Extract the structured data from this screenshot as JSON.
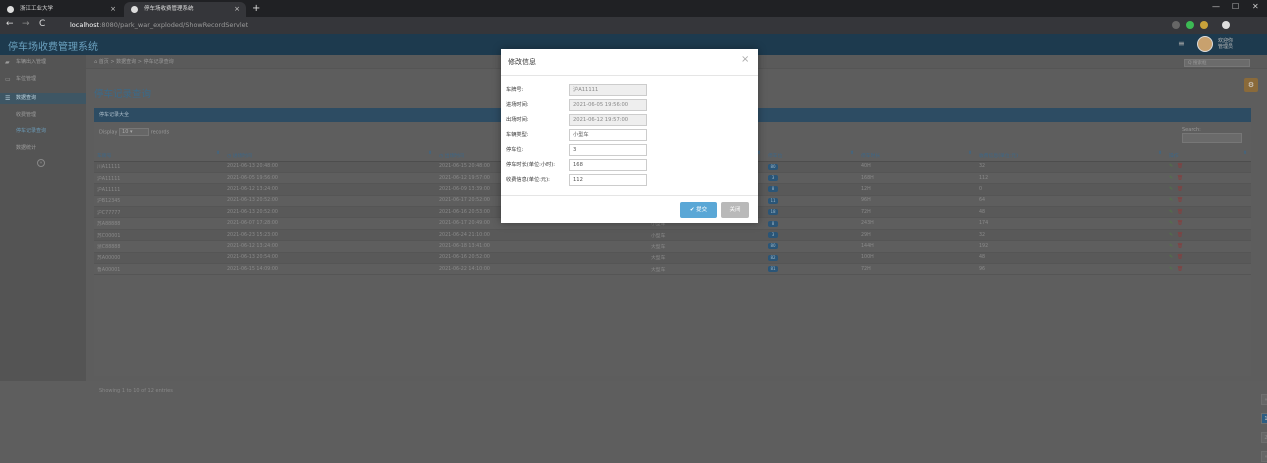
{
  "browser": {
    "tabs": [
      {
        "title": "浙江工业大学",
        "close": "×"
      },
      {
        "title": "停车场收费管理系统",
        "close": "×"
      }
    ],
    "new_tab": "+",
    "window_controls": [
      "—",
      "☐",
      "✕"
    ],
    "nav": {
      "back": "←",
      "forward": "→",
      "reload": "C"
    },
    "url_host": "localhost",
    "url_path": ":8080/park_war_exploded/ShowRecordServlet"
  },
  "app": {
    "brand": "停车场收费管理系统",
    "user_lines": [
      "欢迎你",
      "管理员"
    ],
    "menu_icon": "≡"
  },
  "sidebar": {
    "items": [
      {
        "label": "车辆出入管理",
        "icon": "car-icon"
      },
      {
        "label": "车位管理",
        "icon": "monitor-icon"
      },
      {
        "label": "数据查询",
        "icon": "list-icon"
      }
    ],
    "subitems": [
      "收费管理",
      "停车记录查询",
      "数据统计"
    ],
    "collapse": "«"
  },
  "breadcrumb": {
    "home": "首页",
    "sep": ">",
    "level1": "数据查询",
    "level2": "停车记录查询"
  },
  "search_top": {
    "placeholder": "Q 搜索框"
  },
  "page_title": "停车记录查询",
  "panel": {
    "title": "停车记录大全",
    "display": "Display",
    "page_size": "10",
    "records": "records",
    "search_label": "Search:"
  },
  "table": {
    "headers": [
      "车牌号",
      "◷ 进场时间",
      "◷ 出场时间",
      "车辆类型",
      "停车位",
      "停车时长",
      "收费信息(单位:元)",
      "操作"
    ],
    "rows": [
      [
        "川A11111",
        "2021-06-13 20:48:00",
        "2021-06-15 20:48:00",
        "小型车",
        "80",
        "40H",
        "32"
      ],
      [
        "沪A11111",
        "2021-06-05 19:56:00",
        "2021-06-12 19:57:00",
        "小型车",
        "3",
        "168H",
        "112"
      ],
      [
        "沪A11111",
        "2021-06-12 13:24:00",
        "2021-06-09 13:39:00",
        "小型车",
        "8",
        "12H",
        "0"
      ],
      [
        "沪B12345",
        "2021-06-13 20:52:00",
        "2021-06-17 20:52:00",
        "小型车",
        "11",
        "96H",
        "64"
      ],
      [
        "沪C77777",
        "2021-06-13 20:52:00",
        "2021-06-16 20:53:00",
        "大型车",
        "18",
        "72H",
        "48"
      ],
      [
        "苏A88888",
        "2021-06-07 17:28:00",
        "2021-06-17 20:49:00",
        "小型车",
        "8",
        "243H",
        "174"
      ],
      [
        "苏C00001",
        "2021-06-23 15:23:00",
        "2021-06-24 21:10:00",
        "小型车",
        "3",
        "29H",
        "32"
      ],
      [
        "浙C88888",
        "2021-06-12 13:24:00",
        "2021-06-18 13:41:00",
        "大型车",
        "80",
        "144H",
        "192"
      ],
      [
        "苏A00000",
        "2021-06-13 20:54:00",
        "2021-06-16 20:52:00",
        "大型车",
        "82",
        "100H",
        "48"
      ],
      [
        "鲁A00001",
        "2021-06-15 14:09:00",
        "2021-06-22 14:10:00",
        "大型车",
        "81",
        "72H",
        "96"
      ]
    ]
  },
  "table_info": "Showing 1 to 10 of 12 entries",
  "pager": [
    "«",
    "1",
    "2",
    "»"
  ],
  "modal": {
    "title": "修改信息",
    "close": "×",
    "fields": [
      {
        "label": "车牌号:",
        "value": "沪A11111",
        "readonly": true
      },
      {
        "label": "进场时间:",
        "value": "2021-06-05 19:56:00",
        "readonly": true
      },
      {
        "label": "出场时间:",
        "value": "2021-06-12 19:57:00",
        "readonly": true
      },
      {
        "label": "车辆类型:",
        "value": "小型车",
        "readonly": false
      },
      {
        "label": "停车位:",
        "value": "3",
        "readonly": false
      },
      {
        "label": "停车时长(单位:小时):",
        "value": "168",
        "readonly": false
      },
      {
        "label": "收费信息(单位:元):",
        "value": "112",
        "readonly": false
      }
    ],
    "submit": "✔ 提交",
    "close_btn": "关闭"
  },
  "colors": {
    "header": "#1d3a4e",
    "panel_head": "#2d4c63",
    "primary": "#5aa7d6",
    "badge": "#2a5577"
  }
}
